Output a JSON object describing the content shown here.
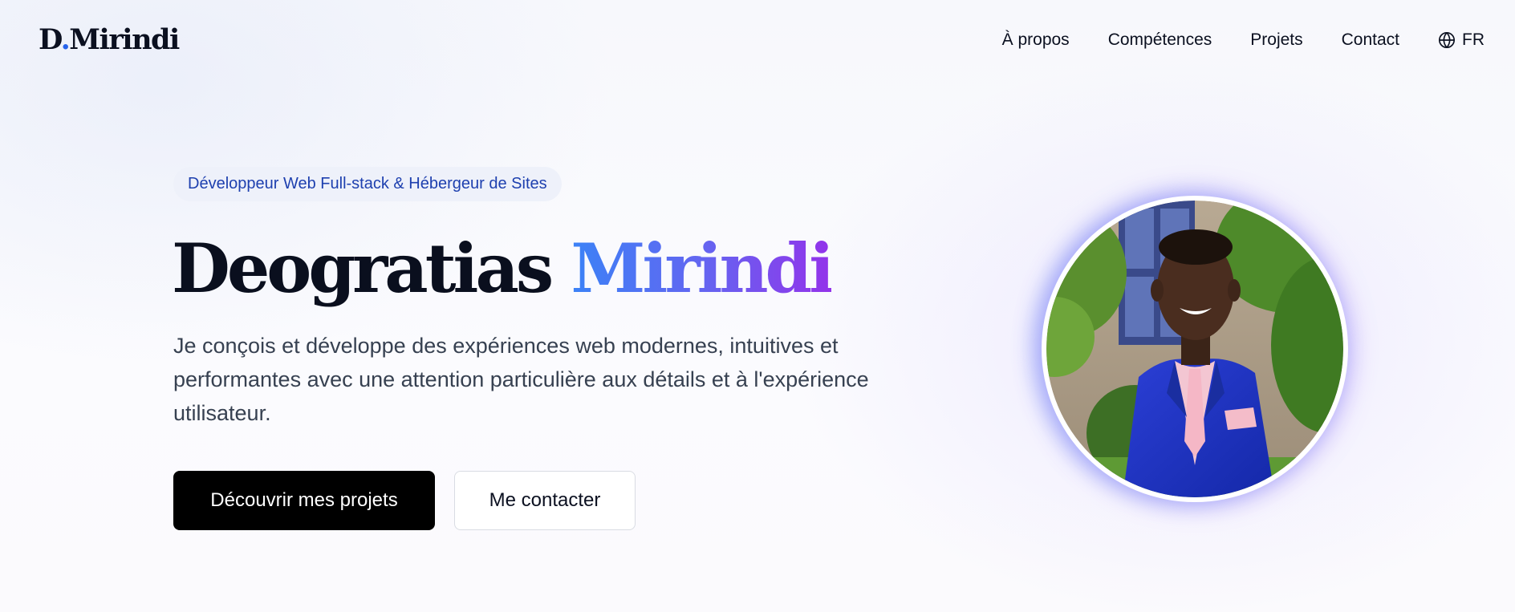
{
  "header": {
    "logo_prefix": "D",
    "logo_dot": ".",
    "logo_suffix": "Mirindi",
    "nav": {
      "about": "À propos",
      "skills": "Compétences",
      "projects": "Projets",
      "contact": "Contact"
    },
    "language": {
      "icon": "globe-icon",
      "label": "FR"
    }
  },
  "hero": {
    "badge": "Développeur Web Full-stack & Hébergeur de Sites",
    "title_first": "Deogratias",
    "title_last": "Mirindi",
    "description": "Je conçois et développe des expériences web modernes, intuitives et performantes avec une attention particulière aux détails et à l'expérience utilisateur.",
    "primary_button": "Découvrir mes projets",
    "secondary_button": "Me contacter"
  },
  "colors": {
    "accent_blue": "#3b82f6",
    "accent_purple": "#9333ea",
    "logo_dot": "#2563eb",
    "badge_text": "#1e40af",
    "primary_button_bg": "#000000"
  }
}
